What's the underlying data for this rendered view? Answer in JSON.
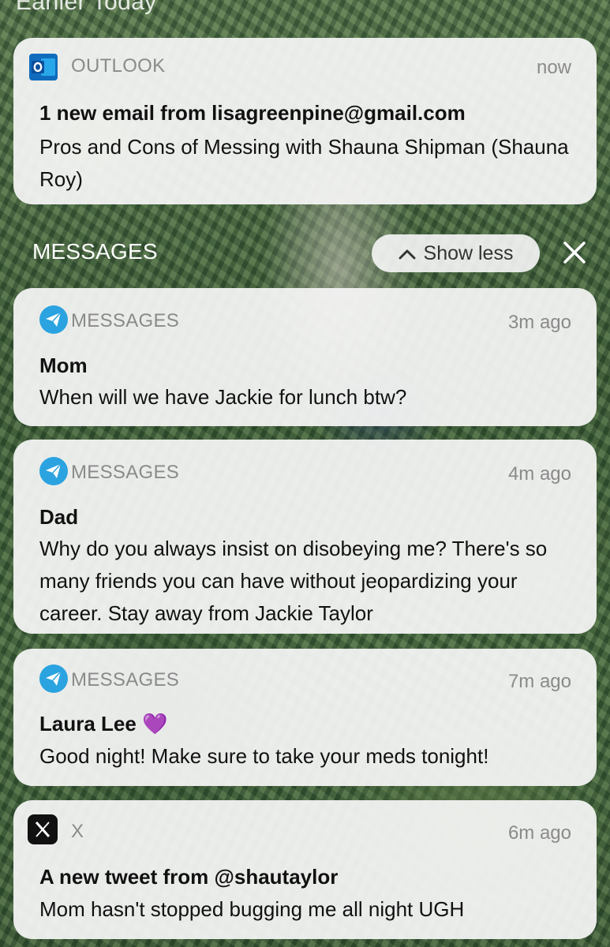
{
  "top_header": {
    "label": "Earlier Today"
  },
  "outlook": {
    "app_name": "OUTLOOK",
    "time": "now",
    "title": "1 new email from lisagreenpine@gmail.com",
    "body": "Pros and Cons of Messing with Shauna Shipman (Shauna Roy)"
  },
  "messages_group": {
    "label": "MESSAGES",
    "show_less_label": "Show less"
  },
  "notifications": [
    {
      "app_name": "MESSAGES",
      "time": "3m ago",
      "title": "Mom",
      "body": "When will we have Jackie for lunch btw?"
    },
    {
      "app_name": "MESSAGES",
      "time": "4m ago",
      "title": "Dad",
      "body": "Why do you always insist on disobeying me? There's so many friends you can have without jeopardizing your career. Stay away from Jackie Taylor"
    },
    {
      "app_name": "MESSAGES",
      "time": "7m ago",
      "title": "Laura Lee 💜",
      "body": "Good night! Make sure to take your meds tonight!"
    }
  ],
  "x_notification": {
    "app_name": "X",
    "time": "6m ago",
    "title": "A new tweet from @shautaylor",
    "body": "Mom hasn't stopped bugging me all night UGH"
  },
  "icons": {
    "outlook": "outlook-icon",
    "messages": "paper-plane-icon",
    "x": "x-logo-icon",
    "show_less": "chevron-up-icon",
    "close": "close-icon"
  },
  "colors": {
    "outlook_blue": "#0f6cbd",
    "messages_blue": "#2aa3e0",
    "card_bg": "#f6f6f6",
    "meta_gray": "#8a8a8a"
  }
}
